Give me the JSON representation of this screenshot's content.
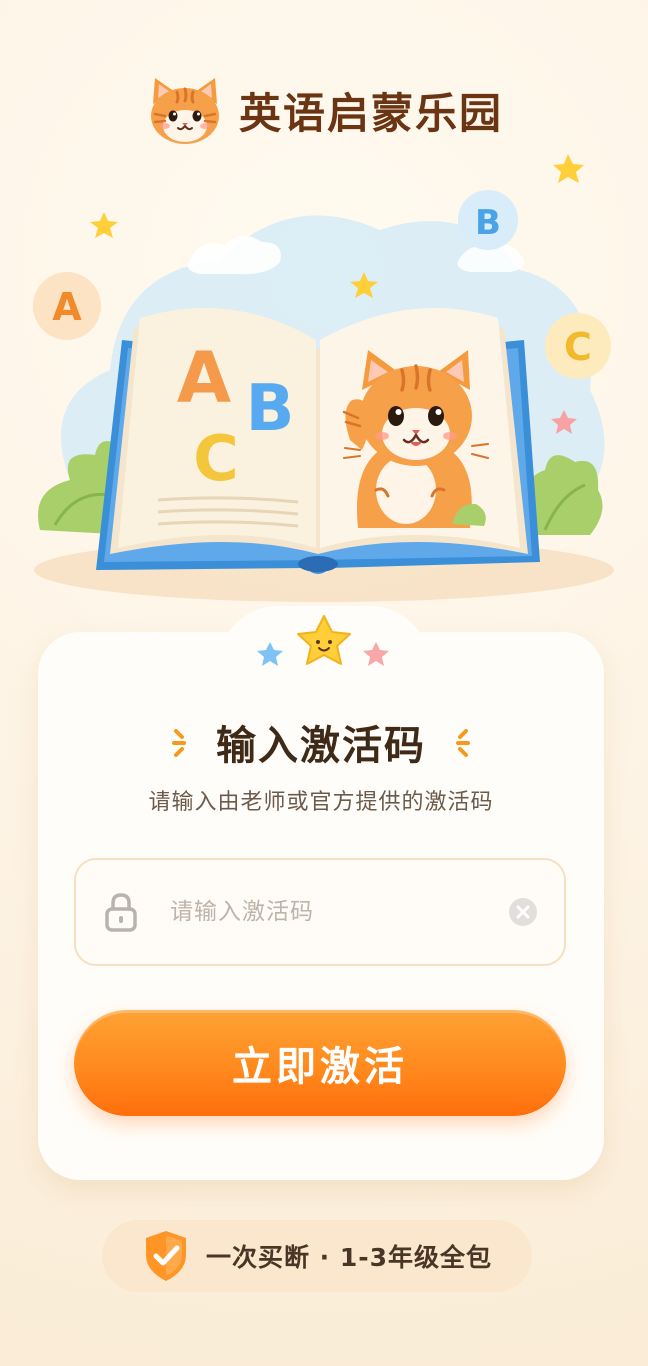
{
  "header": {
    "app_title": "英语启蒙乐园",
    "logo_icon": "cat-face-icon"
  },
  "hero": {
    "letters": [
      "A",
      "B",
      "C"
    ],
    "floating_letters": [
      "A",
      "B",
      "C"
    ]
  },
  "activation_card": {
    "title": "输入激活码",
    "subtitle": "请输入由老师或官方提供的激活码",
    "input": {
      "value": "",
      "placeholder": "请输入激活码",
      "leading_icon": "lock-icon",
      "trailing_icon": "clear-icon"
    },
    "submit_label": "立即激活"
  },
  "footer": {
    "badge_icon": "shield-check-icon",
    "text": "一次买断 · 1-3年级全包"
  },
  "colors": {
    "background": "#fdf3e4",
    "brand_text": "#6b3413",
    "accent_orange": "#ff8a1d",
    "book_blue": "#3a8fd8"
  }
}
